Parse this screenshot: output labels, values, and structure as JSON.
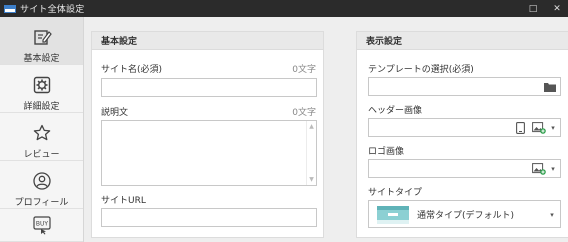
{
  "window": {
    "title": "サイト全体設定",
    "controls": {
      "maximize": "□",
      "close": "✕"
    }
  },
  "sidebar": {
    "items": [
      {
        "label": "基本設定",
        "icon": "edit-icon",
        "active": true
      },
      {
        "label": "詳細設定",
        "icon": "gear-icon",
        "active": false
      },
      {
        "label": "レビュー",
        "icon": "star-icon",
        "active": false
      },
      {
        "label": "プロフィール",
        "icon": "person-icon",
        "active": false
      },
      {
        "label": "",
        "icon": "buy-icon",
        "icon_text": "BUY",
        "active": false
      }
    ]
  },
  "basic": {
    "header": "基本設定",
    "site_name": {
      "label": "サイト名(必須)",
      "counter": "0文字",
      "value": ""
    },
    "description": {
      "label": "説明文",
      "counter": "0文字",
      "value": ""
    },
    "site_url": {
      "label": "サイトURL",
      "value": ""
    }
  },
  "display": {
    "header": "表示設定",
    "template": {
      "label": "テンプレートの選択(必須)",
      "value": "",
      "icon": "folder-icon"
    },
    "header_image": {
      "label": "ヘッダー画像",
      "value": "",
      "icons": [
        "device-icon",
        "image-add-icon",
        "chevron-down-icon"
      ]
    },
    "logo_image": {
      "label": "ロゴ画像",
      "value": "",
      "icons": [
        "image-add-icon",
        "chevron-down-icon"
      ]
    },
    "site_type": {
      "label": "サイトタイプ",
      "selected": "通常タイプ(デフォルト)",
      "icon": "template-thumbnail"
    }
  },
  "colors": {
    "titlebar": "#2b2b2b",
    "accent_thumb": "#8cd0d3"
  }
}
